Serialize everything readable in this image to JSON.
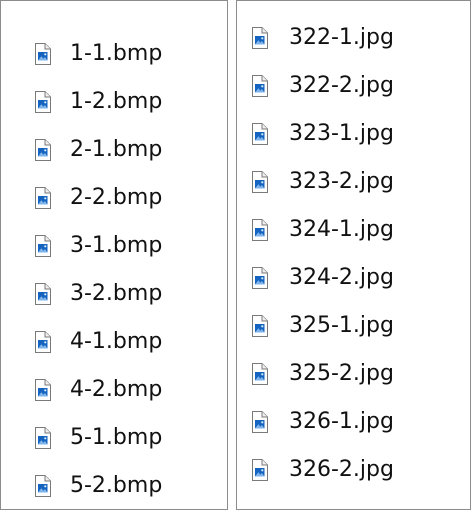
{
  "left_panel": {
    "files": [
      {
        "name": "1-1.bmp",
        "icon": "image-file-icon"
      },
      {
        "name": "1-2.bmp",
        "icon": "image-file-icon"
      },
      {
        "name": "2-1.bmp",
        "icon": "image-file-icon"
      },
      {
        "name": "2-2.bmp",
        "icon": "image-file-icon"
      },
      {
        "name": "3-1.bmp",
        "icon": "image-file-icon"
      },
      {
        "name": "3-2.bmp",
        "icon": "image-file-icon"
      },
      {
        "name": "4-1.bmp",
        "icon": "image-file-icon"
      },
      {
        "name": "4-2.bmp",
        "icon": "image-file-icon"
      },
      {
        "name": "5-1.bmp",
        "icon": "image-file-icon"
      },
      {
        "name": "5-2.bmp",
        "icon": "image-file-icon"
      }
    ]
  },
  "right_panel": {
    "files": [
      {
        "name": "322-1.jpg",
        "icon": "image-file-icon"
      },
      {
        "name": "322-2.jpg",
        "icon": "image-file-icon"
      },
      {
        "name": "323-1.jpg",
        "icon": "image-file-icon"
      },
      {
        "name": "323-2.jpg",
        "icon": "image-file-icon"
      },
      {
        "name": "324-1.jpg",
        "icon": "image-file-icon"
      },
      {
        "name": "324-2.jpg",
        "icon": "image-file-icon"
      },
      {
        "name": "325-1.jpg",
        "icon": "image-file-icon"
      },
      {
        "name": "325-2.jpg",
        "icon": "image-file-icon"
      },
      {
        "name": "326-1.jpg",
        "icon": "image-file-icon"
      },
      {
        "name": "326-2.jpg",
        "icon": "image-file-icon"
      }
    ]
  },
  "colors": {
    "icon_accent": "#1565c0",
    "border": "#8c8c8c",
    "text": "#111111"
  }
}
